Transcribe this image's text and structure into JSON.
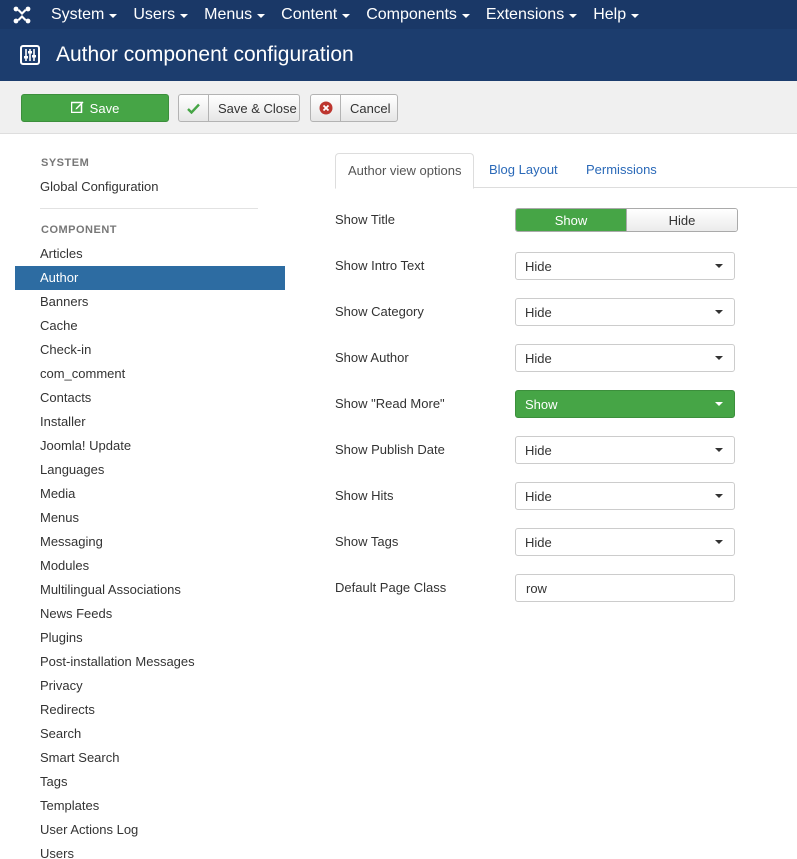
{
  "topnav": {
    "logo_icon": "joomla-logo-icon",
    "items": [
      "System",
      "Users",
      "Menus",
      "Content",
      "Components",
      "Extensions",
      "Help"
    ]
  },
  "header": {
    "icon": "equalizer-icon",
    "title": "Author component configuration"
  },
  "toolbar": {
    "save_label": "Save",
    "save_close_label": "Save & Close",
    "cancel_label": "Cancel"
  },
  "sidebar": {
    "system_heading": "SYSTEM",
    "global_configuration": "Global Configuration",
    "component_heading": "COMPONENT",
    "items": [
      "Articles",
      "Author",
      "Banners",
      "Cache",
      "Check-in",
      "com_comment",
      "Contacts",
      "Installer",
      "Joomla! Update",
      "Languages",
      "Media",
      "Menus",
      "Messaging",
      "Modules",
      "Multilingual Associations",
      "News Feeds",
      "Plugins",
      "Post-installation Messages",
      "Privacy",
      "Redirects",
      "Search",
      "Smart Search",
      "Tags",
      "Templates",
      "User Actions Log",
      "Users"
    ],
    "active": "Author"
  },
  "tabs": [
    "Author view options",
    "Blog Layout",
    "Permissions"
  ],
  "form": {
    "show_title": {
      "label": "Show Title",
      "on": "Show",
      "off": "Hide"
    },
    "show_intro_text": {
      "label": "Show Intro Text",
      "value": "Hide"
    },
    "show_category": {
      "label": "Show Category",
      "value": "Hide"
    },
    "show_author": {
      "label": "Show Author",
      "value": "Hide"
    },
    "show_read_more": {
      "label": "Show \"Read More\"",
      "value": "Show"
    },
    "show_publish_date": {
      "label": "Show Publish Date",
      "value": "Hide"
    },
    "show_hits": {
      "label": "Show Hits",
      "value": "Hide"
    },
    "show_tags": {
      "label": "Show Tags",
      "value": "Hide"
    },
    "default_page_class": {
      "label": "Default Page Class",
      "value": "row"
    }
  },
  "colors": {
    "topnav_bg": "#1a3867",
    "header_bg": "#1c3d6e",
    "accent_green": "#46a546",
    "active_blue": "#2d6ca2",
    "link_blue": "#2a69b8"
  }
}
